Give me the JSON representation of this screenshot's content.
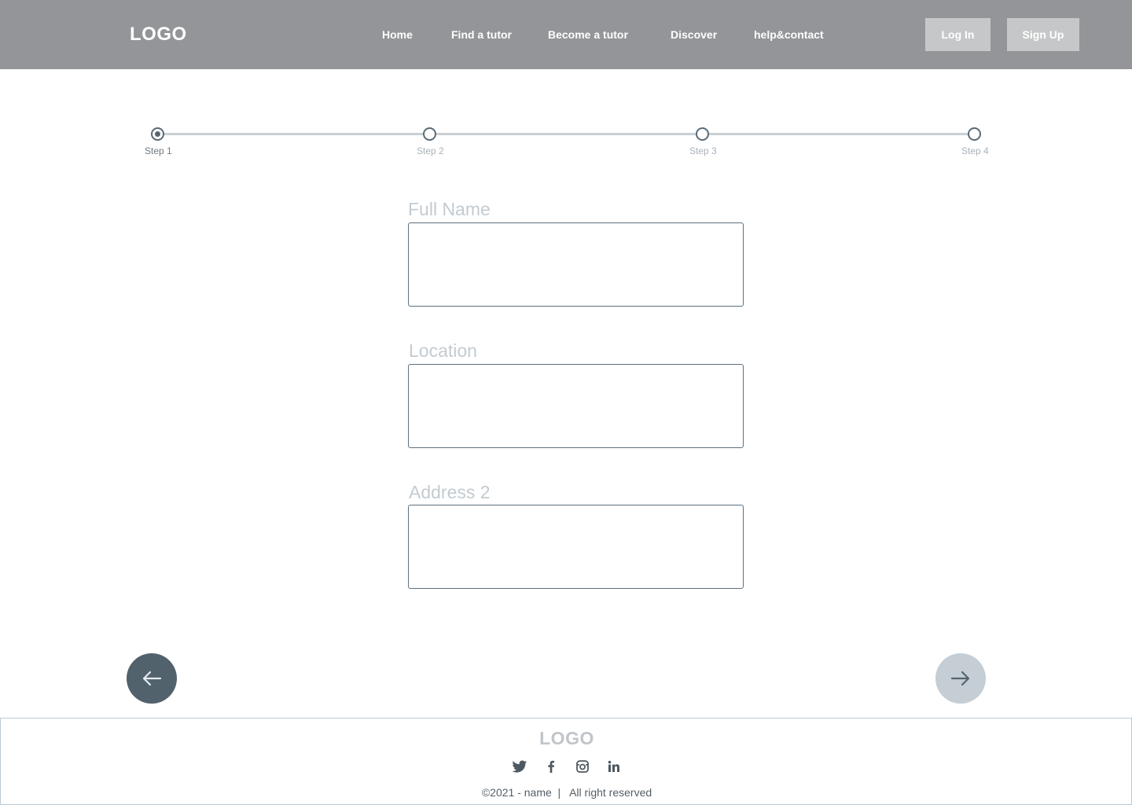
{
  "header": {
    "logo": "LOGO",
    "nav": [
      "Home",
      "Find a tutor",
      "Become a tutor",
      "Discover",
      "help&contact"
    ],
    "login_label": "Log In",
    "signup_label": "Sign Up"
  },
  "stepper": {
    "steps": [
      "Step 1",
      "Step 2",
      "Step 3",
      "Step 4"
    ],
    "current_step": 1
  },
  "form": {
    "fields": [
      {
        "label": "Full Name",
        "value": ""
      },
      {
        "label": "Location",
        "value": ""
      },
      {
        "label": "Address 2",
        "value": ""
      }
    ]
  },
  "navigation": {
    "prev_icon": "arrow-left-icon",
    "next_icon": "arrow-right-icon"
  },
  "footer": {
    "logo": "LOGO",
    "social_icons": [
      "twitter-icon",
      "facebook-icon",
      "instagram-icon",
      "linkedin-icon"
    ],
    "copyright": "©2021 - name  |   All right reserved"
  },
  "colors": {
    "header_bg": "#939599",
    "button_bg": "#c6c7c9",
    "prev_button": "#51626d",
    "next_button": "#c4ced4",
    "input_border": "#5c707e"
  }
}
